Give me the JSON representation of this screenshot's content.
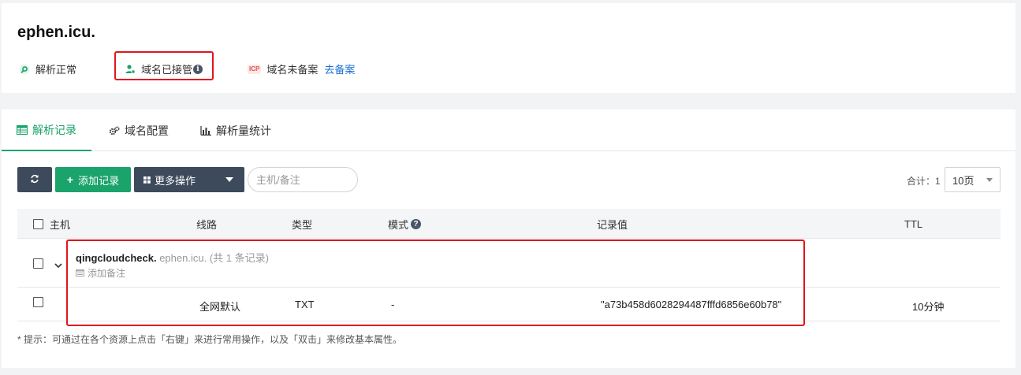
{
  "domain": {
    "name": "ephen.icu."
  },
  "status": [
    {
      "label": "解析正常",
      "icon": "dns-search-icon"
    },
    {
      "label": "域名已接管",
      "icon": "user-shield-icon",
      "info": "i"
    },
    {
      "badge": "ICP",
      "label": "域名未备案",
      "link": "去备案"
    }
  ],
  "tabs": [
    {
      "label": "解析记录",
      "icon": "table-icon",
      "active": true
    },
    {
      "label": "域名配置",
      "icon": "cogs-icon",
      "active": false
    },
    {
      "label": "解析量统计",
      "icon": "bar-chart-icon",
      "active": false
    }
  ],
  "toolbar": {
    "refresh_icon": "refresh-icon",
    "add_label": "添加记录",
    "add_icon": "plus-icon",
    "more_label": "更多操作",
    "more_icon": "grid-icon",
    "search_placeholder": "主机/备注",
    "total_label": "合计：1",
    "page_size": "10页"
  },
  "table": {
    "columns": {
      "host": "主机",
      "line": "线路",
      "type": "类型",
      "mode": "模式",
      "mode_help": "?",
      "value": "记录值",
      "ttl": "TTL"
    },
    "group": {
      "host": "qingcloudcheck.",
      "domain": "ephen.icu.",
      "count": "(共 1 条记录)",
      "remark": "添加备注"
    },
    "rows": [
      {
        "line": "全网默认",
        "type": "TXT",
        "mode": "-",
        "value": "\"a73b458d6028294487fffd6856e60b78\"",
        "ttl": "10分钟"
      }
    ]
  },
  "tip": "* 提示：可通过在各个资源上点击「右键」来进行常用操作，以及「双击」来修改基本属性。",
  "colors": {
    "accent": "#1aa36b",
    "dark_button": "#3d4a5c",
    "link": "#1b6fd0",
    "highlight": "#e0161d"
  }
}
